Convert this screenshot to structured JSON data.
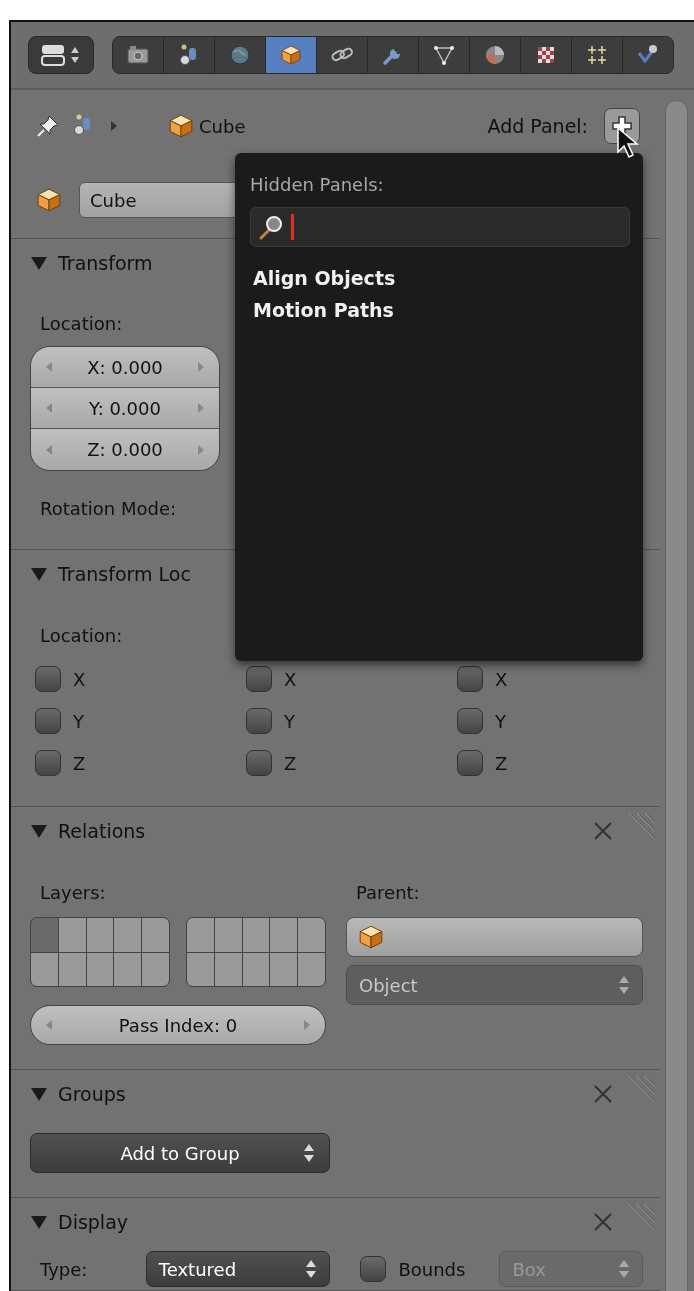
{
  "header": {
    "editor_type": {
      "kind": "properties"
    },
    "tabs": [
      {
        "kind": "render",
        "selected": false
      },
      {
        "kind": "scene",
        "selected": false
      },
      {
        "kind": "world",
        "selected": false
      },
      {
        "kind": "object",
        "selected": true
      },
      {
        "kind": "constraints",
        "selected": false
      },
      {
        "kind": "modifiers",
        "selected": false
      },
      {
        "kind": "data",
        "selected": false
      },
      {
        "kind": "material",
        "selected": false
      },
      {
        "kind": "texture",
        "selected": false
      },
      {
        "kind": "particles",
        "selected": false
      },
      {
        "kind": "physics",
        "selected": false
      }
    ]
  },
  "breadcrumb": {
    "object": "Cube",
    "add_panel_label": "Add Panel:"
  },
  "object_name": {
    "value": "Cube"
  },
  "panels": [
    {
      "kind": "transform",
      "title": "Transform",
      "expanded": true,
      "location_label": "Location:",
      "fields": [
        "X: 0.000",
        "Y: 0.000",
        "Z: 0.000"
      ],
      "rotation_label": "Rotation Mode:"
    },
    {
      "kind": "locks",
      "title": "Transform Loc",
      "expanded": true,
      "location_label": "Location:",
      "columns": [
        [
          {
            "label": "X",
            "checked": false
          },
          {
            "label": "Y",
            "checked": false
          },
          {
            "label": "Z",
            "checked": false
          }
        ],
        [
          {
            "label": "X",
            "checked": false
          },
          {
            "label": "Y",
            "checked": false
          },
          {
            "label": "Z",
            "checked": false
          }
        ],
        [
          {
            "label": "X",
            "checked": false
          },
          {
            "label": "Y",
            "checked": false
          },
          {
            "label": "Z",
            "checked": false
          }
        ]
      ]
    },
    {
      "kind": "relations",
      "title": "Relations",
      "expanded": true,
      "closable": true,
      "layers_label": "Layers:",
      "layers": [
        [
          true,
          false,
          false,
          false,
          false,
          false,
          false,
          false,
          false,
          false
        ],
        [
          false,
          false,
          false,
          false,
          false,
          false,
          false,
          false,
          false,
          false
        ]
      ],
      "parent_label": "Parent:",
      "parent_type": "Object",
      "pass_index": "Pass Index: 0"
    },
    {
      "kind": "groups",
      "title": "Groups",
      "expanded": true,
      "closable": true,
      "add_button": "Add to Group"
    },
    {
      "kind": "display",
      "title": "Display",
      "expanded": true,
      "closable": true,
      "type_label": "Type:",
      "type_value": "Textured",
      "bounds": {
        "label": "Bounds",
        "checked": false
      },
      "bounds_type": {
        "value": "Box",
        "disabled": true
      }
    }
  ],
  "popup": {
    "title": "Hidden Panels:",
    "items": [
      "Align Objects",
      "Motion Paths"
    ]
  }
}
